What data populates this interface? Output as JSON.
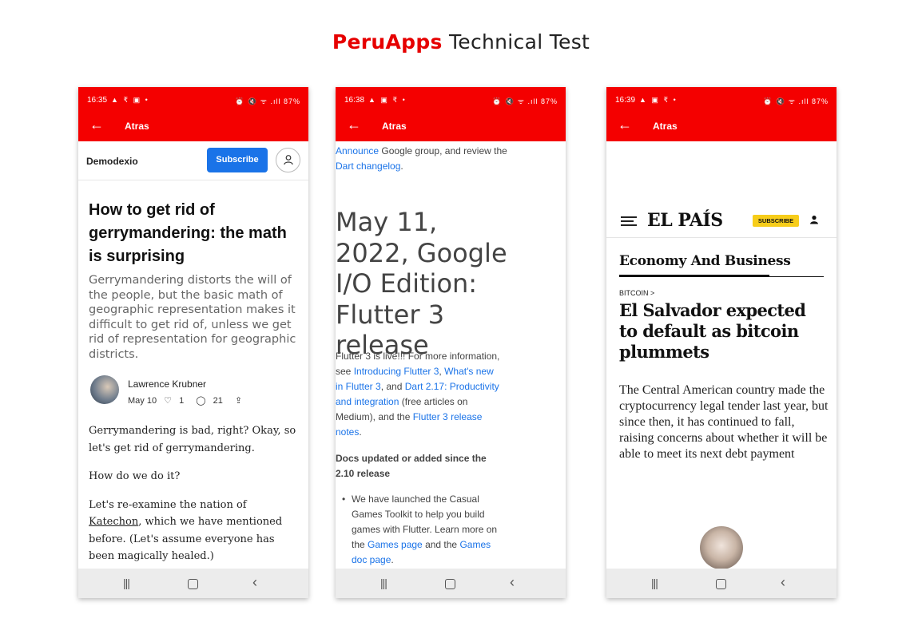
{
  "page": {
    "title_brand": "PeruApps",
    "title_rest": " Technical Test"
  },
  "phones": [
    {
      "status": {
        "time": "16:35",
        "left_icons": "▲ ₹ ▣ •",
        "right_icons": "⏰ 🔇 ᯤ .ıll 87%"
      },
      "appbar": {
        "back_icon": "←",
        "title": "Atras"
      },
      "header": {
        "publication": "Demodexio",
        "subscribe": "Subscribe"
      },
      "article": {
        "title": "How to get rid of gerrymandering: the math is surprising",
        "subtitle": "Gerrymandering distorts the will of the people, but the basic math of geographic representation makes it difficult to get rid of, unless we get rid of representation for geographic districts.",
        "author": "Lawrence Krubner",
        "date": "May 10",
        "likes": "1",
        "comments": "21",
        "p1": "Gerrymandering is bad, right? Okay, so let's get rid of gerrymandering.",
        "p2": "How do we do it?",
        "p3_before": "Let's re-examine the nation of ",
        "p3_link": "Katechon",
        "p3_after": ", which we have mentioned before. (Let's assume everyone has been magically healed.)"
      }
    },
    {
      "status": {
        "time": "16:38",
        "left_icons": "▲ ▣ ₹ •",
        "right_icons": "⏰ 🔇 ᯤ .ıll 87%"
      },
      "appbar": {
        "back_icon": "←",
        "title": "Atras"
      },
      "doc": {
        "top_link1": "Announce",
        "top_text1": " Google group, and review the ",
        "top_link2": "Dart changelog",
        "top_text2": ".",
        "heading": "May 11, 2022, Google I/O Edition: Flutter 3 release",
        "para_text1": "Flutter 3 is live!!! For more information, see ",
        "para_link1": "Introducing Flutter 3",
        "para_text2": ", ",
        "para_link2": "What's new in Flutter 3",
        "para_text3": ", and ",
        "para_link3": "Dart 2.17: Productivity and integration",
        "para_text4": " (free articles on Medium), and the ",
        "para_link4": "Flutter 3 release notes",
        "para_text5": ".",
        "subheading": "Docs updated or added since the 2.10 release",
        "bullet_text1": "We have launched the Casual Games Toolkit to help you build games with Flutter. Learn more on the ",
        "bullet_link1": "Games page",
        "bullet_text2": " and the ",
        "bullet_link2": "Games doc page",
        "bullet_text3": "."
      }
    },
    {
      "status": {
        "time": "16:39",
        "left_icons": "▲ ▣ ₹ •",
        "right_icons": "⏰ 🔇 ᯤ .ıll 87%"
      },
      "appbar": {
        "back_icon": "←",
        "title": "Atras"
      },
      "news": {
        "logo": "EL PAÍS",
        "subscribe": "SUBSCRIBE",
        "section": "Economy And Business",
        "tag": "BITCOIN >",
        "headline": "El Salvador expected to default as bitcoin plummets",
        "lead": "The Central American country made the cryptocurrency legal tender last year, but since then, it has continued to fall, raising concerns about whether it will be able to meet its next debt payment"
      }
    }
  ],
  "navbar": {
    "recents": "|||",
    "back": "‹"
  },
  "colors": {
    "brand_red": "#f40000",
    "link_blue": "#1a73e8",
    "subscribe_yellow": "#f7cd1a"
  }
}
